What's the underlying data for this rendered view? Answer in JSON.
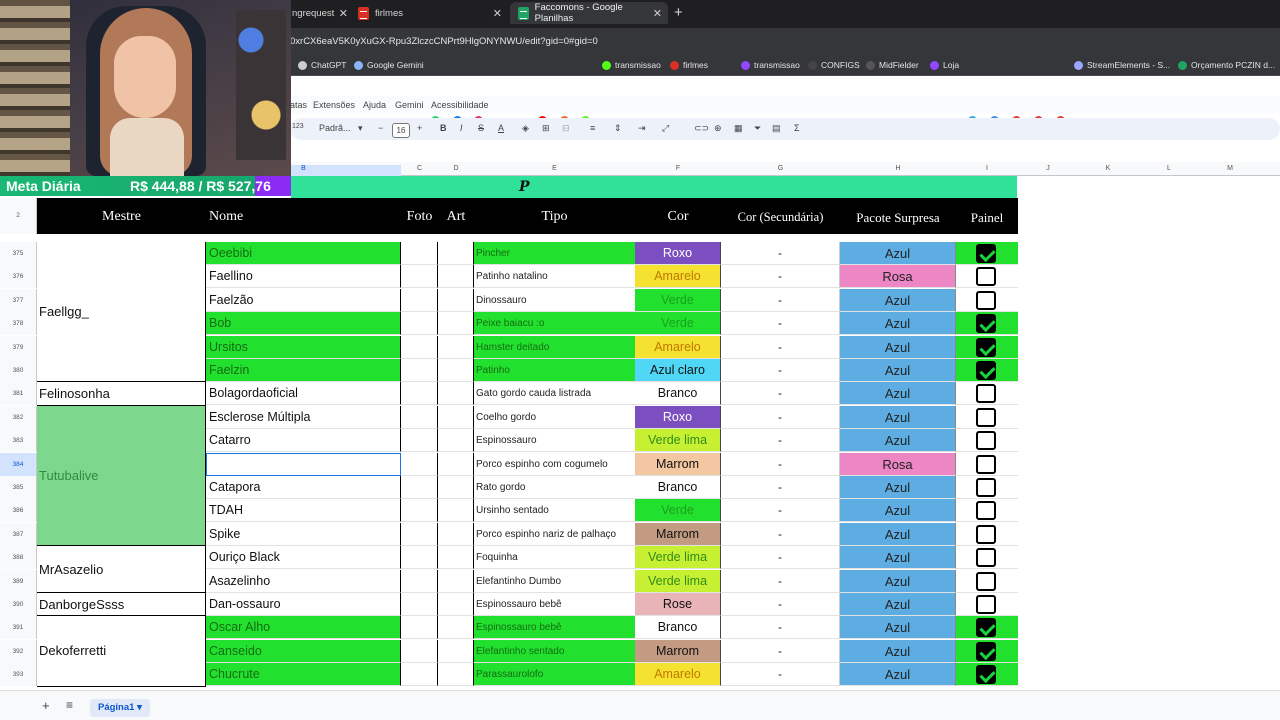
{
  "browser": {
    "tabs": [
      {
        "label": "ngrequest"
      },
      {
        "label": "firlmes"
      },
      {
        "label": "Faccomons - Google Planilhas"
      }
    ],
    "url": "0xrCX6eaV5K0yXuGX-Rpu3ZlczcCNPrt9HlgONYNWU/edit?gid=0#gid=0",
    "bookmarks": [
      "ChatGPT",
      "Google Gemini",
      "transmissao",
      "firlmes",
      "transmissao",
      "CONFIGS",
      "MidFielder",
      "Loja",
      "StreamElements - S...",
      "Orçamento PCZIN d..."
    ]
  },
  "menu": [
    "atas",
    "Extensões",
    "Ajuda",
    "Gemini",
    "Acessibilidade"
  ],
  "toolbar": {
    "number_format": "123",
    "font": "Padrã...",
    "font_size": "16"
  },
  "columns": [
    "B",
    "C",
    "D",
    "E",
    "F",
    "G",
    "H",
    "I",
    "J",
    "K",
    "L",
    "M"
  ],
  "overlay": {
    "label": "Meta Diária",
    "value": "R$ 444,88 / R$ 527,76"
  },
  "banner": {
    "letter": "P"
  },
  "header": {
    "row_number": "2",
    "mestre": "Mestre",
    "nome": "Nome",
    "foto": "Foto",
    "art": "Art",
    "tipo": "Tipo",
    "cor": "Cor",
    "cor2": "Cor (Secundária)",
    "pacote": "Pacote Surpresa",
    "painel": "Painel"
  },
  "mestres": [
    {
      "name": "Faellgg_",
      "first_row": 375,
      "span": 6,
      "bg": "#ffffff",
      "color": "#111111"
    },
    {
      "name": "Felinosonha",
      "first_row": 381,
      "span": 1,
      "bg": "#ffffff",
      "color": "#111111"
    },
    {
      "name": "Tutubalive",
      "first_row": 382,
      "span": 6,
      "bg": "#7dd88e",
      "color": "#2f8c3c"
    },
    {
      "name": "MrAsazelio",
      "first_row": 388,
      "span": 2,
      "bg": "#ffffff",
      "color": "#111111"
    },
    {
      "name": "DanborgeSsss",
      "first_row": 390,
      "span": 1,
      "bg": "#ffffff",
      "color": "#111111"
    },
    {
      "name": "Dekoferretti",
      "first_row": 391,
      "span": 3,
      "bg": "#ffffff",
      "color": "#111111"
    }
  ],
  "rows": [
    {
      "n": "375",
      "nome": "Oeebibi",
      "tipo": "Pincher",
      "cor": "Roxo",
      "cor_bg": "#7b4fbf",
      "cor_fg": "#ffffff",
      "cor2": "-",
      "pacote": "Azul",
      "pac_bg": "#5dade2",
      "painel": true,
      "green": true
    },
    {
      "n": "376",
      "nome": "Faellino",
      "tipo": "Patinho natalino",
      "cor": "Amarelo",
      "cor_bg": "#f5e12f",
      "cor_fg": "#c07a00",
      "cor2": "-",
      "pacote": "Rosa",
      "pac_bg": "#ec86c4",
      "painel": false,
      "green": false
    },
    {
      "n": "377",
      "nome": "Faelzão",
      "tipo": "Dinossauro",
      "cor": "Verde",
      "cor_bg": "#22e12e",
      "cor_fg": "#1aa01f",
      "cor2": "-",
      "pacote": "Azul",
      "pac_bg": "#5dade2",
      "painel": false,
      "green": false
    },
    {
      "n": "378",
      "nome": "Bob",
      "tipo": "Peixe baiacu :o",
      "cor": "Verde",
      "cor_bg": "#22e12e",
      "cor_fg": "#1aa01f",
      "cor2": "-",
      "pacote": "Azul",
      "pac_bg": "#5dade2",
      "painel": true,
      "green": true
    },
    {
      "n": "379",
      "nome": "Ursitos",
      "tipo": "Hamster deitado",
      "cor": "Amarelo",
      "cor_bg": "#f5e12f",
      "cor_fg": "#c07a00",
      "cor2": "-",
      "pacote": "Azul",
      "pac_bg": "#5dade2",
      "painel": true,
      "green": true
    },
    {
      "n": "380",
      "nome": "Faelzin",
      "tipo": "Patinho",
      "cor": "Azul claro",
      "cor_bg": "#4fd7f5",
      "cor_fg": "#111111",
      "cor2": "-",
      "pacote": "Azul",
      "pac_bg": "#5dade2",
      "painel": true,
      "green": true
    },
    {
      "n": "381",
      "nome": "Bolagordaoficial",
      "tipo": "Gato gordo cauda listrada",
      "cor": "Branco",
      "cor_bg": "#ffffff",
      "cor_fg": "#111111",
      "cor2": "-",
      "pacote": "Azul",
      "pac_bg": "#5dade2",
      "painel": false,
      "green": false
    },
    {
      "n": "382",
      "nome": "Esclerose Múltipla",
      "tipo": "Coelho gordo",
      "cor": "Roxo",
      "cor_bg": "#7b4fbf",
      "cor_fg": "#ffffff",
      "cor2": "-",
      "pacote": "Azul",
      "pac_bg": "#5dade2",
      "painel": false,
      "green": false
    },
    {
      "n": "383",
      "nome": "Catarro",
      "tipo": "Espinossauro",
      "cor": "Verde lima",
      "cor_bg": "#c8f032",
      "cor_fg": "#2f8c1c",
      "cor2": "-",
      "pacote": "Azul",
      "pac_bg": "#5dade2",
      "painel": false,
      "green": false
    },
    {
      "n": "384",
      "nome": "",
      "tipo": "Porco espinho com cogumelo",
      "cor": "Marrom",
      "cor_bg": "#f3c7a1",
      "cor_fg": "#111111",
      "cor2": "-",
      "pacote": "Rosa",
      "pac_bg": "#ec86c4",
      "painel": false,
      "green": false,
      "selected": true
    },
    {
      "n": "385",
      "nome": "Catapora",
      "tipo": "Rato gordo",
      "cor": "Branco",
      "cor_bg": "#ffffff",
      "cor_fg": "#111111",
      "cor2": "-",
      "pacote": "Azul",
      "pac_bg": "#5dade2",
      "painel": false,
      "green": false
    },
    {
      "n": "386",
      "nome": "TDAH",
      "tipo": "Ursinho sentado",
      "cor": "Verde",
      "cor_bg": "#22e12e",
      "cor_fg": "#1aa01f",
      "cor2": "-",
      "pacote": "Azul",
      "pac_bg": "#5dade2",
      "painel": false,
      "green": false
    },
    {
      "n": "387",
      "nome": "Spike",
      "tipo": "Porco espinho nariz de palhaço",
      "cor": "Marrom",
      "cor_bg": "#c39a82",
      "cor_fg": "#111111",
      "cor2": "-",
      "pacote": "Azul",
      "pac_bg": "#5dade2",
      "painel": false,
      "green": false
    },
    {
      "n": "388",
      "nome": "Ouriço Black",
      "tipo": "Foquinha",
      "cor": "Verde lima",
      "cor_bg": "#c8f032",
      "cor_fg": "#2f8c1c",
      "cor2": "-",
      "pacote": "Azul",
      "pac_bg": "#5dade2",
      "painel": false,
      "green": false
    },
    {
      "n": "389",
      "nome": "Asazelinho",
      "tipo": "Elefantinho Dumbo",
      "cor": "Verde lima",
      "cor_bg": "#c8f032",
      "cor_fg": "#2f8c1c",
      "cor2": "-",
      "pacote": "Azul",
      "pac_bg": "#5dade2",
      "painel": false,
      "green": false
    },
    {
      "n": "390",
      "nome": "Dan-ossauro",
      "tipo": "Espinossauro bebê",
      "cor": "Rose",
      "cor_bg": "#e8b4b8",
      "cor_fg": "#111111",
      "cor2": "-",
      "pacote": "Azul",
      "pac_bg": "#5dade2",
      "painel": false,
      "green": false
    },
    {
      "n": "391",
      "nome": "Oscar Alho",
      "tipo": "Espinossauro bebê",
      "cor": "Branco",
      "cor_bg": "#ffffff",
      "cor_fg": "#111111",
      "cor2": "-",
      "pacote": "Azul",
      "pac_bg": "#5dade2",
      "painel": true,
      "green": true
    },
    {
      "n": "392",
      "nome": "Canseido",
      "tipo": "Elefantinho sentado",
      "cor": "Marrom",
      "cor_bg": "#c39a82",
      "cor_fg": "#111111",
      "cor2": "-",
      "pacote": "Azul",
      "pac_bg": "#5dade2",
      "painel": true,
      "green": true
    },
    {
      "n": "393",
      "nome": "Chucrute",
      "tipo": "Parassaurolofo",
      "cor": "Amarelo",
      "cor_bg": "#f5e12f",
      "cor_fg": "#c07a00",
      "cor2": "-",
      "pacote": "Azul",
      "pac_bg": "#5dade2",
      "painel": true,
      "green": true
    }
  ],
  "colors": {
    "row_green": "#22e12e",
    "teal_banner": "#30e19a",
    "meta_purple": "#8b2cf5"
  },
  "sheet_tab": "Página1"
}
